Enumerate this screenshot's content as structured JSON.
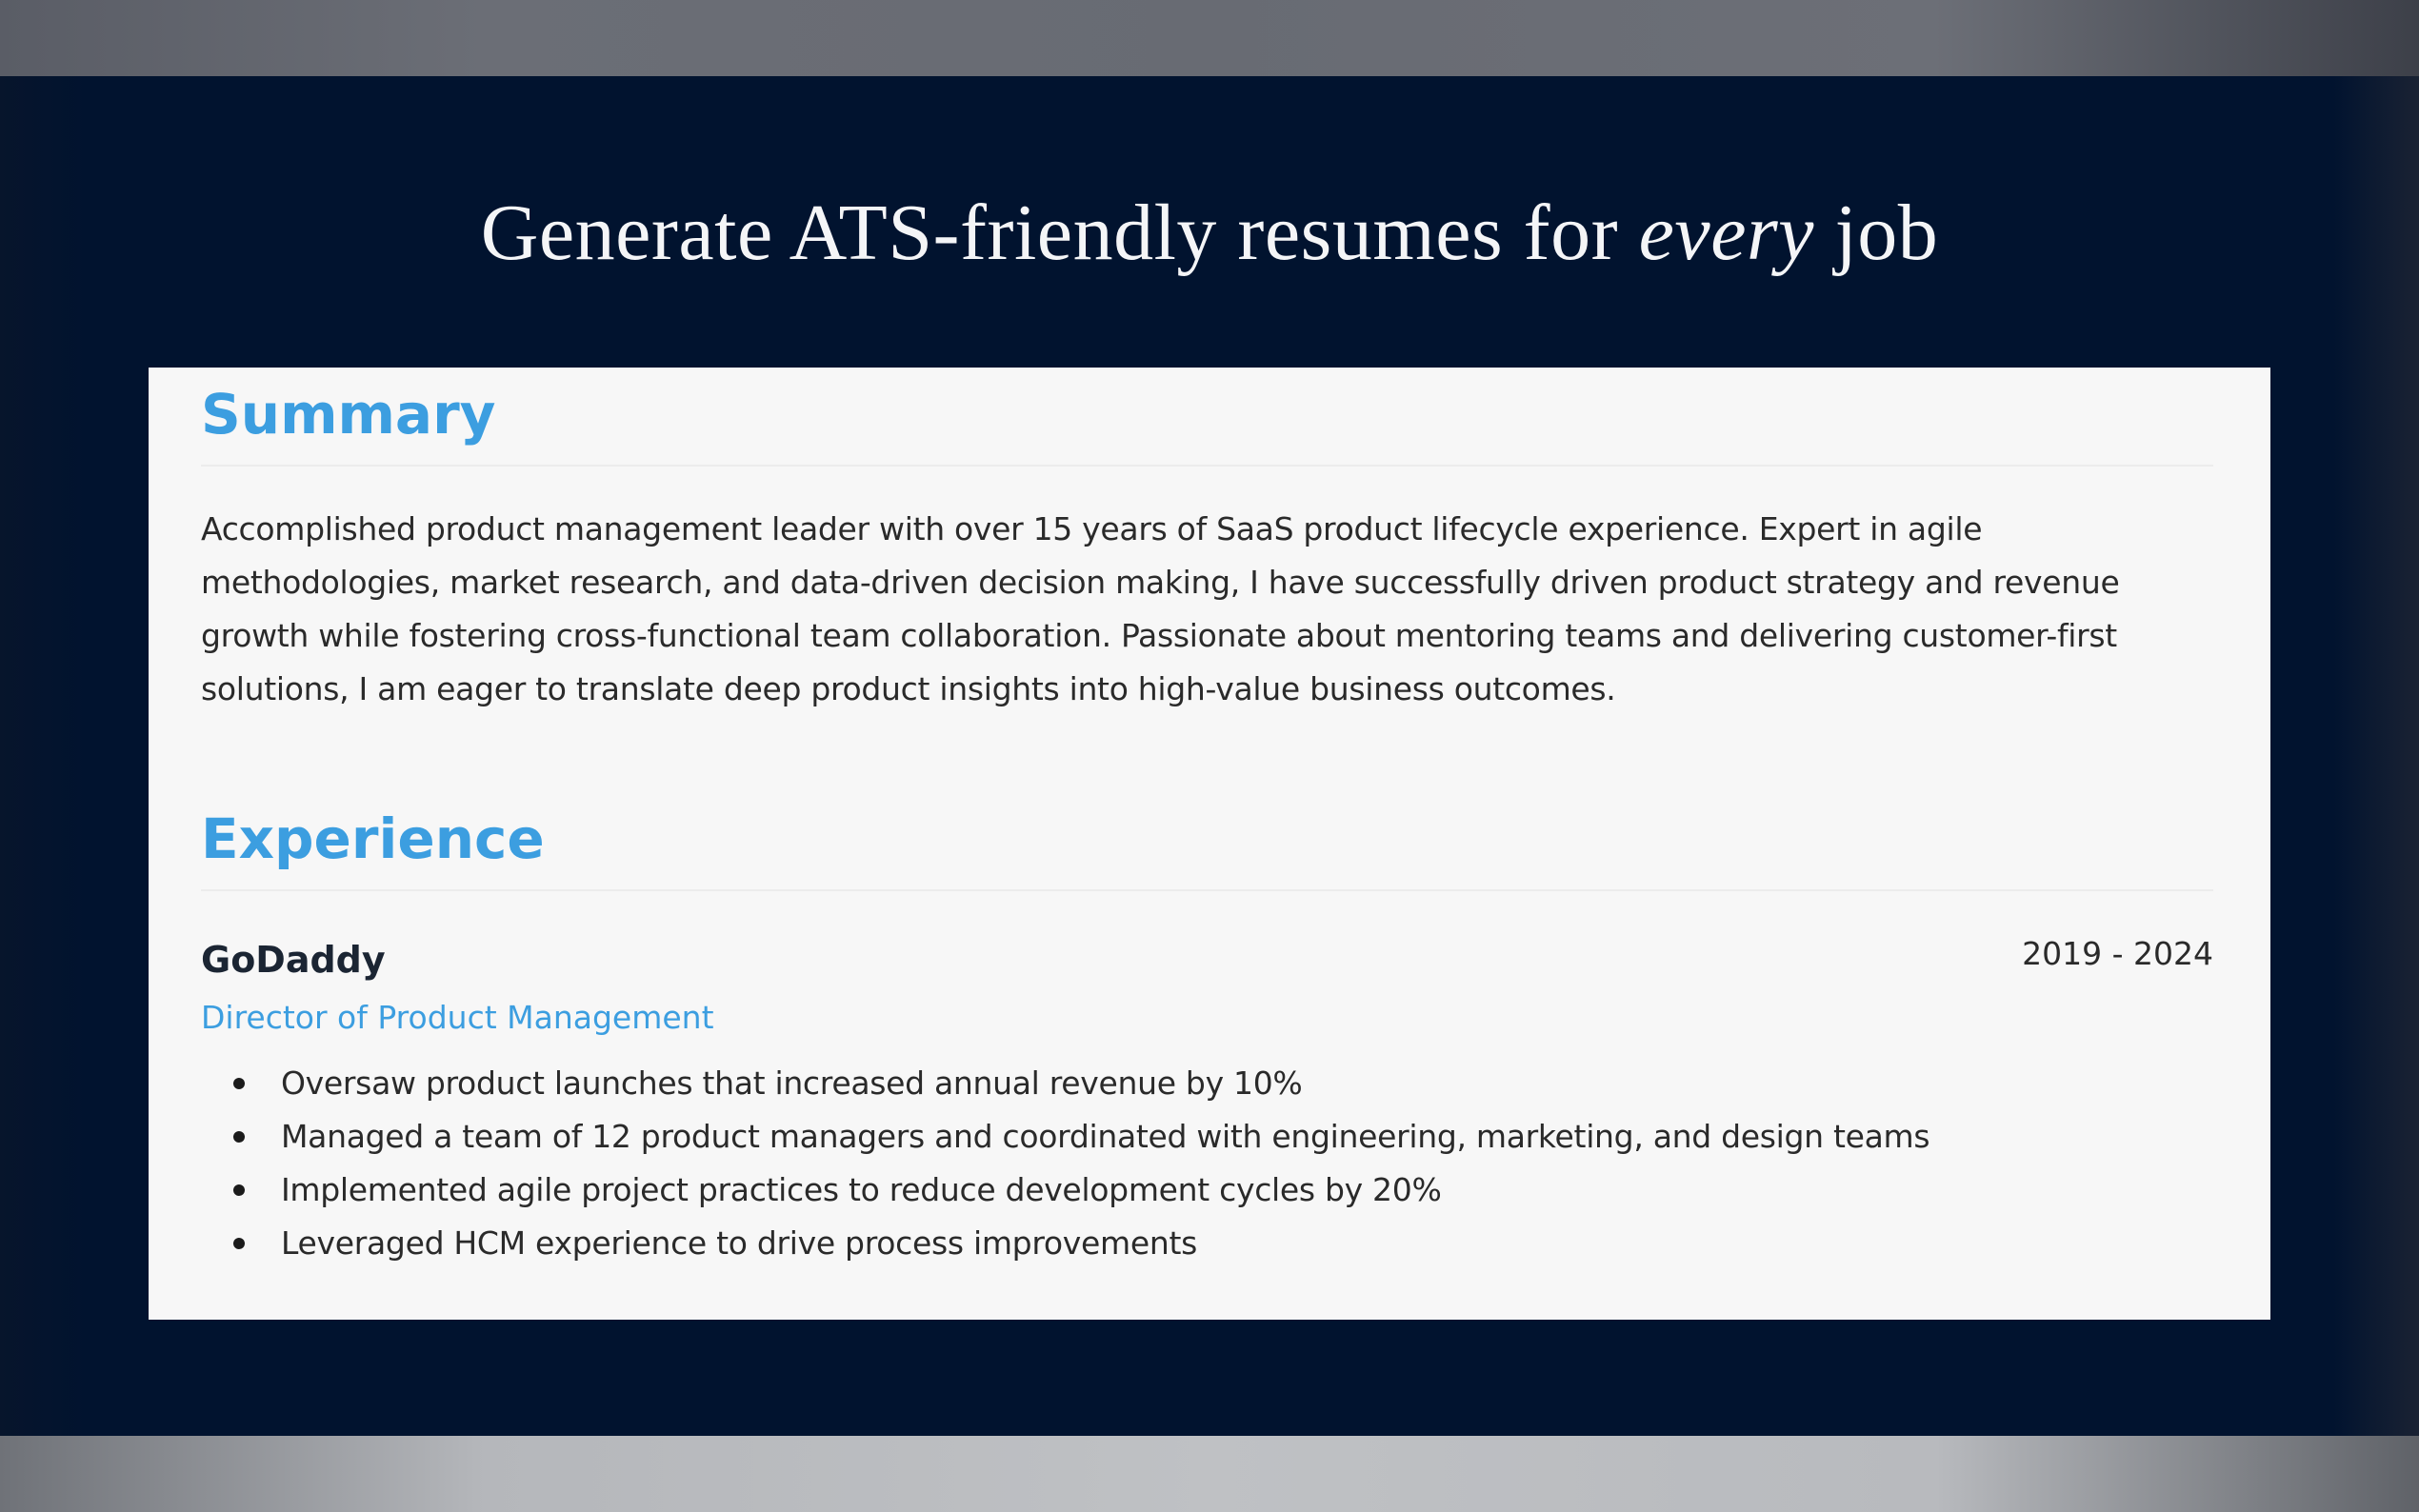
{
  "headline": {
    "prefix": "Generate ATS-friendly resumes for ",
    "emphasis": "every",
    "suffix": " job"
  },
  "summary": {
    "heading": "Summary",
    "text": "Accomplished product management leader with over 15 years of SaaS product lifecycle experience. Expert in agile methodologies, market research, and data-driven decision making, I have successfully driven product strategy and revenue growth while fostering cross-functional team collaboration. Passionate about mentoring teams and delivering customer-first solutions, I am eager to translate deep product insights into high-value business outcomes."
  },
  "experience": {
    "heading": "Experience",
    "jobs": [
      {
        "company": "GoDaddy",
        "dates": "2019 - 2024",
        "title": "Director of Product Management",
        "bullets": [
          "Oversaw product launches that increased annual revenue by 10%",
          "Managed a team of 12 product managers and coordinated with engineering, marketing, and design teams",
          "Implemented agile project practices to reduce development cycles by 20%",
          "Leveraged HCM experience to drive process improvements"
        ]
      }
    ]
  },
  "colors": {
    "background": "#01132f",
    "accent": "#3c9ee0",
    "card": "#f7f7f7"
  }
}
